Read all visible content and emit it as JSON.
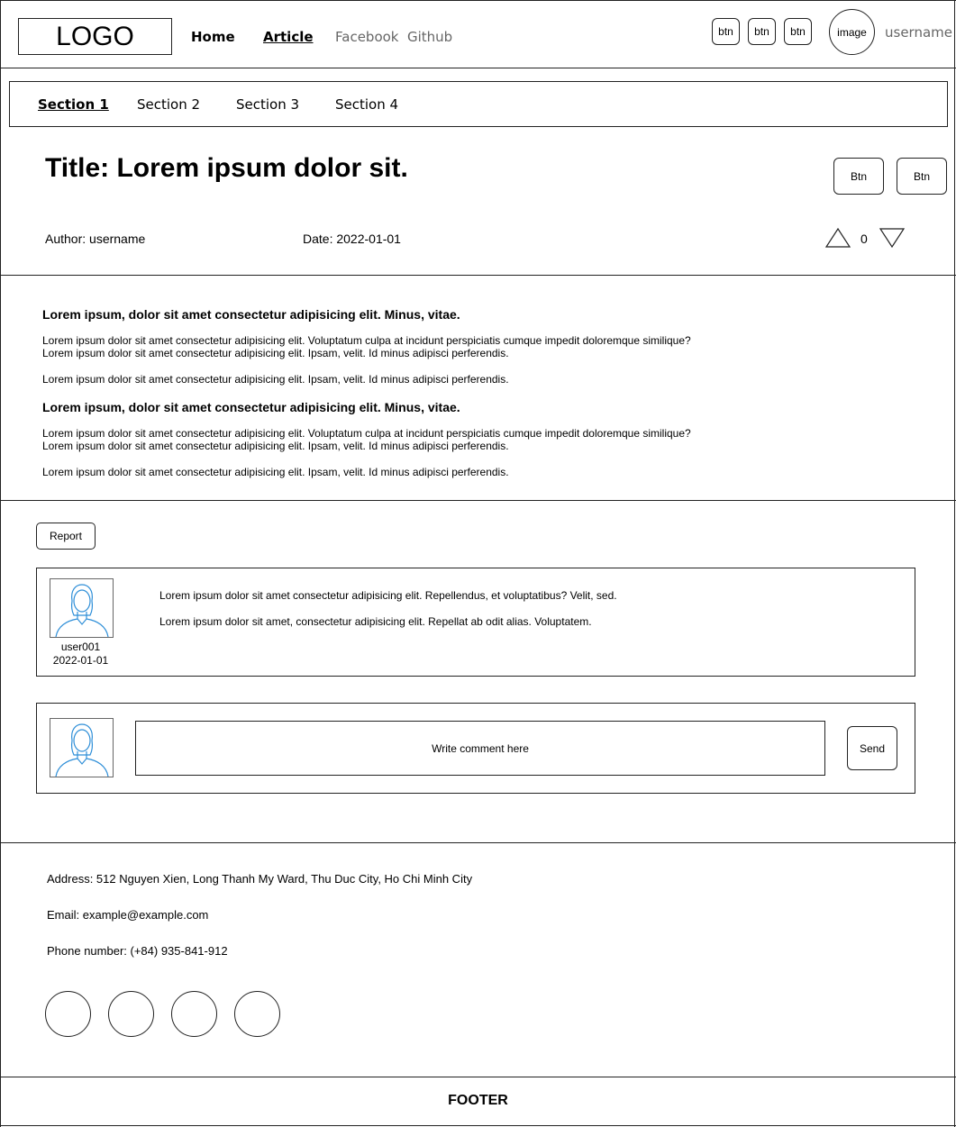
{
  "header": {
    "logo": "LOGO",
    "nav": [
      {
        "label": "Home"
      },
      {
        "label": "Article"
      },
      {
        "label": "Facebook"
      },
      {
        "label": "Github"
      }
    ],
    "buttons": [
      "btn",
      "btn",
      "btn"
    ],
    "avatar_label": "image",
    "username": "username"
  },
  "sections": [
    "Section 1",
    "Section 2",
    "Section 3",
    "Section 4"
  ],
  "article": {
    "title": "Title: Lorem ipsum dolor sit.",
    "buttons": [
      "Btn",
      "Btn"
    ],
    "author": "Author: username",
    "date": "Date: 2022-01-01",
    "votes": "0",
    "blocks": [
      {
        "heading": "Lorem ipsum, dolor sit amet consectetur adipisicing elit. Minus, vitae.",
        "para1": "Lorem ipsum dolor sit amet consectetur adipisicing elit. Voluptatum culpa at incidunt perspiciatis cumque impedit doloremque similique?",
        "para1b": "Lorem ipsum dolor sit amet consectetur adipisicing elit. Ipsam, velit. Id minus adipisci perferendis.",
        "para2": "Lorem ipsum dolor sit amet consectetur adipisicing elit. Ipsam, velit. Id minus adipisci perferendis."
      },
      {
        "heading": "Lorem ipsum, dolor sit amet consectetur adipisicing elit. Minus, vitae.",
        "para1": "Lorem ipsum dolor sit amet consectetur adipisicing elit. Voluptatum culpa at incidunt perspiciatis cumque impedit doloremque similique?",
        "para1b": "Lorem ipsum dolor sit amet consectetur adipisicing elit. Ipsam, velit. Id minus adipisci perferendis.",
        "para2": "Lorem ipsum dolor sit amet consectetur adipisicing elit. Ipsam, velit. Id minus adipisci perferendis."
      }
    ]
  },
  "comments": {
    "report_label": "Report",
    "items": [
      {
        "user": "user001",
        "date": "2022-01-01",
        "line1": "Lorem ipsum dolor sit amet consectetur adipisicing elit. Repellendus, et voluptatibus? Velit, sed.",
        "line2": "Lorem ipsum dolor sit amet, consectetur adipisicing elit. Repellat ab odit alias. Voluptatem."
      }
    ],
    "input_placeholder": "Write comment here",
    "send_label": "Send"
  },
  "footer": {
    "address": "Address: 512 Nguyen Xien, Long Thanh My Ward, Thu Duc City, Ho Chi Minh City",
    "email": "Email: example@example.com",
    "phone": "Phone number: (+84) 935-841-912",
    "social_count": 4,
    "label": "FOOTER"
  },
  "colors": {
    "line": "#222222",
    "muted_text": "#666666",
    "avatar_stroke": "#2f8fd8"
  }
}
